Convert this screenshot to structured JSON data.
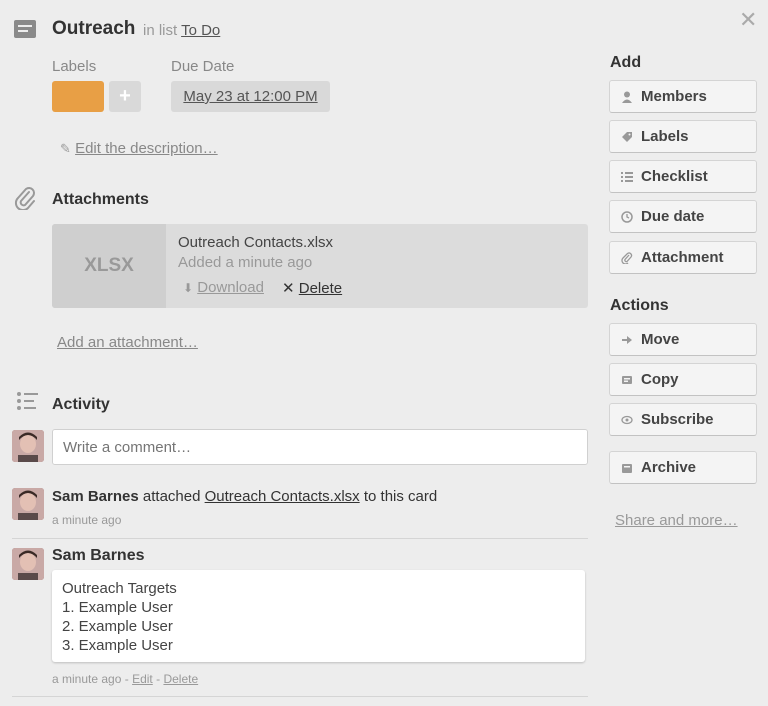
{
  "card": {
    "title": "Outreach",
    "in_list_prefix": "in list",
    "list_name": "To Do"
  },
  "fields": {
    "labels_heading": "Labels",
    "due_heading": "Due Date",
    "label_color": "#e89f45",
    "add_label_symbol": "+",
    "due_value": "May 23 at 12:00 PM"
  },
  "description": {
    "edit_link": "Edit the description…"
  },
  "attachments": {
    "title": "Attachments",
    "items": [
      {
        "thumb_text": "XLSX",
        "file_name": "Outreach Contacts.xlsx",
        "added": "Added a minute ago",
        "download_label": "Download",
        "delete_label": "Delete"
      }
    ],
    "add_link": "Add an attachment…"
  },
  "activity": {
    "title": "Activity",
    "comment_placeholder": "Write a comment…",
    "entries": [
      {
        "user": "Sam Barnes",
        "action_text": "attached",
        "object_link": "Outreach Contacts.xlsx",
        "suffix": "to this card",
        "time": "a minute ago"
      },
      {
        "user": "Sam Barnes",
        "comment_lines": [
          "Outreach Targets",
          "1. Example User",
          "2. Example User",
          "3. Example User"
        ],
        "time": "a minute ago",
        "edit_label": "Edit",
        "delete_label": "Delete",
        "separator": "-"
      }
    ]
  },
  "sidebar": {
    "add_heading": "Add",
    "add_buttons": [
      {
        "label": "Members",
        "icon": "person-icon"
      },
      {
        "label": "Labels",
        "icon": "tag-icon"
      },
      {
        "label": "Checklist",
        "icon": "checklist-icon"
      },
      {
        "label": "Due date",
        "icon": "clock-icon"
      },
      {
        "label": "Attachment",
        "icon": "paperclip-icon"
      }
    ],
    "actions_heading": "Actions",
    "action_buttons": [
      {
        "label": "Move",
        "icon": "arrow-right-icon"
      },
      {
        "label": "Copy",
        "icon": "copy-icon"
      },
      {
        "label": "Subscribe",
        "icon": "eye-icon"
      },
      {
        "label": "Archive",
        "icon": "archive-icon"
      }
    ],
    "share_link": "Share and more…"
  },
  "colors": {
    "background": "#ededed",
    "label_orange": "#e89f45"
  }
}
